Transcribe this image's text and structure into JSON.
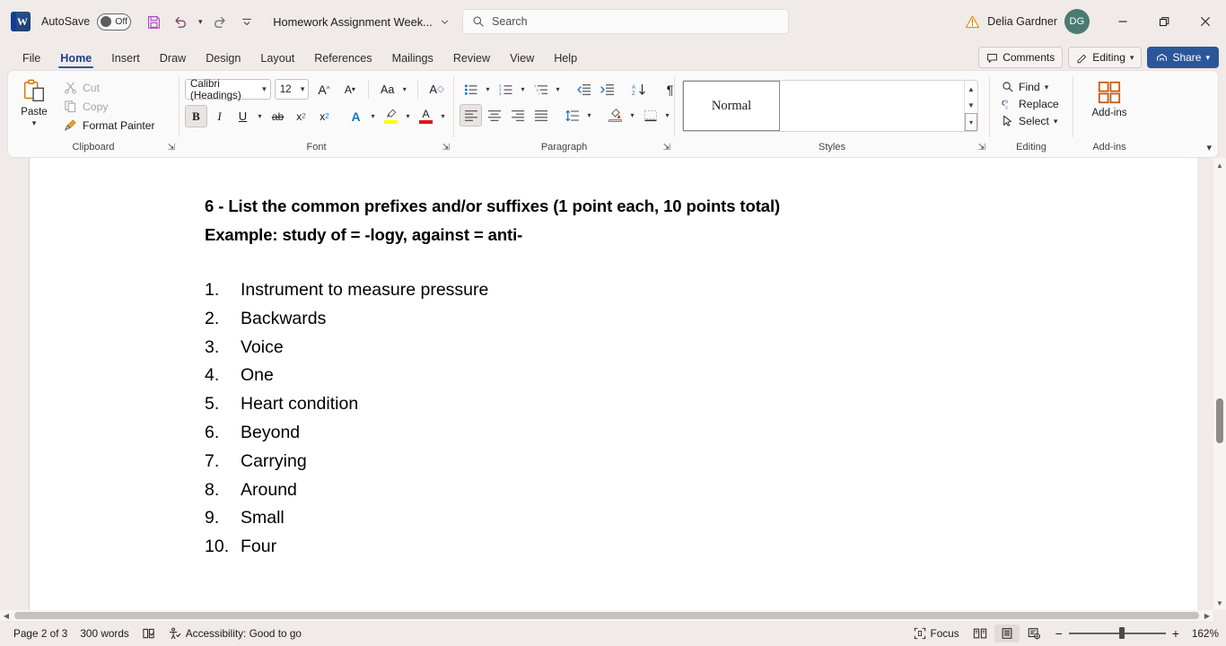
{
  "titlebar": {
    "app_logo": "word-logo",
    "autosave_label": "AutoSave",
    "autosave_state": "Off",
    "save_icon": "save-icon",
    "undo_icon": "undo-icon",
    "redo_icon": "redo-icon",
    "customize_icon": "customize-quick-access-toolbar-icon",
    "document_title": "Homework Assignment Week...",
    "search_placeholder": "Search",
    "search_icon": "search-icon",
    "warning_icon": "warning-icon",
    "user_name": "Delia Gardner",
    "user_initials": "DG",
    "minimize": "minimize-icon",
    "restore": "restore-icon",
    "close": "close-icon"
  },
  "tabs": [
    {
      "label": "File",
      "active": false
    },
    {
      "label": "Home",
      "active": true
    },
    {
      "label": "Insert",
      "active": false
    },
    {
      "label": "Draw",
      "active": false
    },
    {
      "label": "Design",
      "active": false
    },
    {
      "label": "Layout",
      "active": false
    },
    {
      "label": "References",
      "active": false
    },
    {
      "label": "Mailings",
      "active": false
    },
    {
      "label": "Review",
      "active": false
    },
    {
      "label": "View",
      "active": false
    },
    {
      "label": "Help",
      "active": false
    }
  ],
  "tab_right": {
    "comments_label": "Comments",
    "editing_label": "Editing",
    "share_label": "Share"
  },
  "ribbon": {
    "clipboard": {
      "group_label": "Clipboard",
      "paste_label": "Paste",
      "cut_label": "Cut",
      "copy_label": "Copy",
      "format_painter_label": "Format Painter"
    },
    "font": {
      "group_label": "Font",
      "font_name": "Calibri (Headings)",
      "font_size": "12",
      "grow_font": "grow-font-icon",
      "shrink_font": "shrink-font-icon",
      "change_case": "Aa",
      "clear_formatting": "clear-formatting-icon",
      "bold": "B",
      "italic": "I",
      "underline": "U",
      "strikethrough": "ab",
      "subscript": "x",
      "superscript": "x",
      "text_effects": "A",
      "highlight": "A",
      "font_color": "A",
      "bold_active": true
    },
    "paragraph": {
      "group_label": "Paragraph",
      "bullets": "bullets-icon",
      "numbering": "numbering-icon",
      "multilevel": "multilevel-list-icon",
      "decrease_indent": "decrease-indent-icon",
      "increase_indent": "increase-indent-icon",
      "sort": "sort-icon",
      "show_marks": "¶",
      "align_left": "align-left-icon",
      "align_center": "align-center-icon",
      "align_right": "align-right-icon",
      "justify": "justify-icon",
      "line_spacing": "line-spacing-icon",
      "shading": "shading-icon",
      "borders": "borders-icon",
      "align_left_active": true
    },
    "styles": {
      "group_label": "Styles",
      "items": [
        "Normal"
      ]
    },
    "editing": {
      "group_label": "Editing",
      "find_label": "Find",
      "replace_label": "Replace",
      "select_label": "Select"
    },
    "addins": {
      "group_label": "Add-ins",
      "button_label": "Add-ins"
    }
  },
  "document": {
    "heading_line1": "6 - List the common prefixes and/or suffixes (1 point each, 10 points total)",
    "heading_line2": "Example: study of = -logy, against = anti-",
    "list": [
      {
        "num": "1.",
        "text": "Instrument to measure pressure"
      },
      {
        "num": "2.",
        "text": "Backwards"
      },
      {
        "num": "3.",
        "text": "Voice"
      },
      {
        "num": "4.",
        "text": "One"
      },
      {
        "num": "5.",
        "text": "Heart condition"
      },
      {
        "num": "6.",
        "text": "Beyond"
      },
      {
        "num": "7.",
        "text": "Carrying"
      },
      {
        "num": "8.",
        "text": "Around"
      },
      {
        "num": "9.",
        "text": "Small"
      },
      {
        "num": "10.",
        "text": "Four"
      }
    ]
  },
  "statusbar": {
    "page_info": "Page 2 of 3",
    "word_count": "300 words",
    "proofing_icon": "proofing-icon",
    "accessibility": "Accessibility: Good to go",
    "focus_label": "Focus",
    "view_read": "read-mode-icon",
    "view_print": "print-layout-icon",
    "view_web": "web-layout-icon",
    "zoom_out": "−",
    "zoom_in": "+",
    "zoom_level": "162%"
  },
  "colors": {
    "accent": "#2b579a",
    "chrome": "#f0eae9",
    "ribbon": "#fbfafa",
    "avatar": "#4a7a72",
    "addins_orange": "#c55a11"
  }
}
